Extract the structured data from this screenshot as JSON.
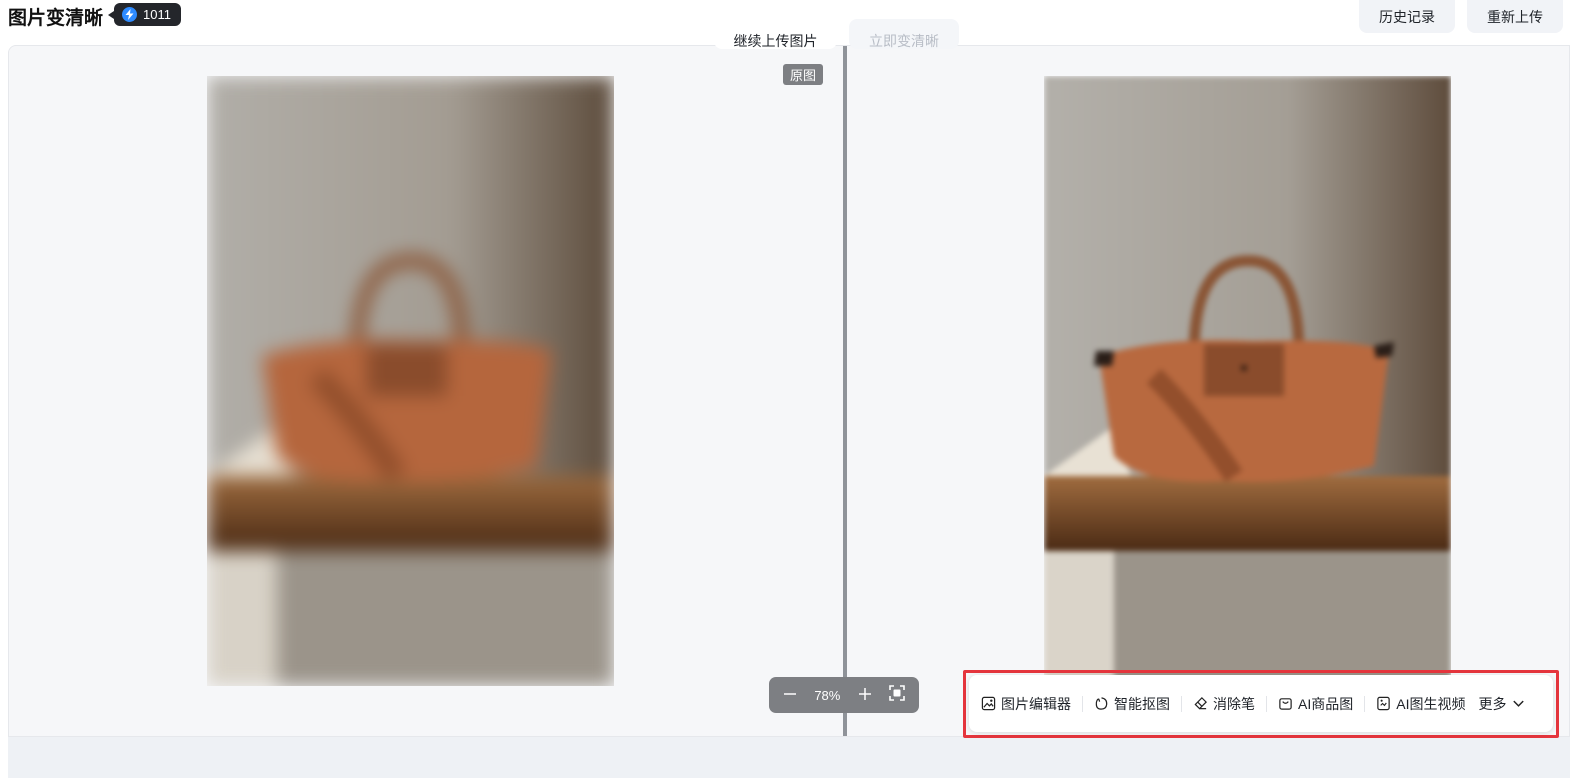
{
  "header": {
    "title": "图片变清晰",
    "credits": "1011",
    "history_label": "历史记录",
    "reupload_label": "重新上传"
  },
  "viewer": {
    "original_tag": "原图",
    "zoom_level": "78%"
  },
  "toolbar": {
    "items": [
      {
        "label": "图片编辑器",
        "icon": "image-edit-icon"
      },
      {
        "label": "智能抠图",
        "icon": "cutout-icon"
      },
      {
        "label": "消除笔",
        "icon": "eraser-icon"
      },
      {
        "label": "AI商品图",
        "icon": "product-bag-icon"
      },
      {
        "label": "AI图生视频",
        "icon": "image-to-video-icon"
      }
    ],
    "more_label": "更多"
  },
  "footer": {
    "continue_label": "继续上传图片",
    "enhance_label": "立即变清晰"
  },
  "colors": {
    "accent_blue": "#2e8bff",
    "highlight_red": "#e5353d",
    "panel_bg": "#f6f7f9"
  }
}
